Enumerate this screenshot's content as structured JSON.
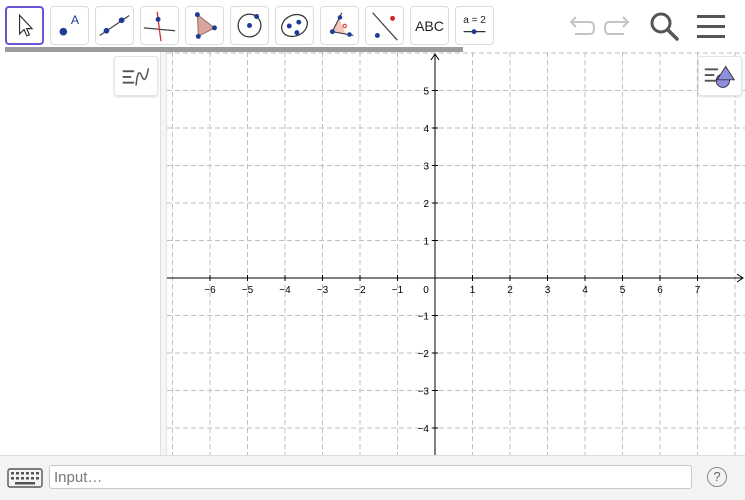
{
  "toolbar": {
    "tools": [
      {
        "name": "move-tool",
        "icon": "arrow-cursor-icon",
        "selected": true
      },
      {
        "name": "point-tool",
        "icon": "point-icon",
        "label": "A"
      },
      {
        "name": "line-tool",
        "icon": "line-through-points-icon"
      },
      {
        "name": "perpendicular-line-tool",
        "icon": "perpendicular-line-icon"
      },
      {
        "name": "polygon-tool",
        "icon": "polygon-icon"
      },
      {
        "name": "circle-tool",
        "icon": "circle-center-point-icon"
      },
      {
        "name": "ellipse-tool",
        "icon": "ellipse-icon"
      },
      {
        "name": "angle-tool",
        "icon": "angle-icon"
      },
      {
        "name": "reflect-tool",
        "icon": "reflect-about-line-icon"
      },
      {
        "name": "text-tool",
        "icon": "text-icon",
        "label": "ABC"
      },
      {
        "name": "slider-tool",
        "icon": "slider-icon",
        "label": "a = 2"
      }
    ],
    "undo_icon": "undo-icon",
    "redo_icon": "redo-icon",
    "search_icon": "search-icon",
    "menu_icon": "hamburger-menu-icon"
  },
  "algebra": {
    "style_button_icon": "algebra-style-icon"
  },
  "graphics": {
    "style_button_icon": "graphics-style-icon",
    "x_ticks": [
      "−6",
      "−5",
      "−4",
      "−3",
      "−2",
      "−1",
      "0",
      "1",
      "2",
      "3",
      "4",
      "5",
      "6",
      "7"
    ],
    "y_ticks": [
      "5",
      "4",
      "3",
      "2",
      "1",
      "−1",
      "−2",
      "−3",
      "−4"
    ],
    "grid": true,
    "grid_style": "dashed",
    "axis_color": "#000000",
    "grid_color": "#c0c0c0"
  },
  "input_bar": {
    "placeholder": "Input…",
    "keyboard_icon": "keyboard-icon",
    "help_label": "?"
  },
  "colors": {
    "selection_border": "#6557d2",
    "point_color": "#1e3c96",
    "polygon_fill": "#d9a49a",
    "accent_red": "#cc2a2a"
  }
}
